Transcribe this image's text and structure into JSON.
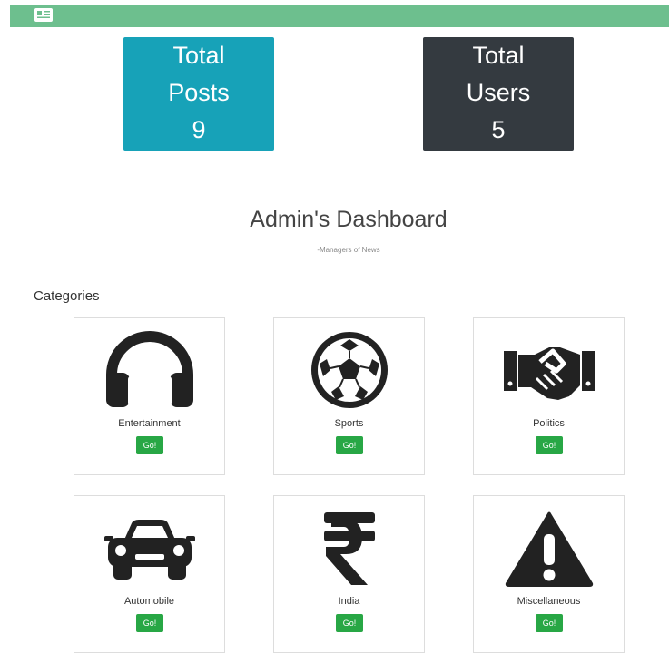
{
  "topbar": {
    "icon": "newspaper-icon",
    "color": "#6dbf8e"
  },
  "stats": {
    "posts": {
      "line1": "Total",
      "line2": "Posts",
      "value": "9",
      "color": "#17a2b8"
    },
    "users": {
      "line1": "Total",
      "line2": "Users",
      "value": "5",
      "color": "#343a40"
    }
  },
  "dashboard": {
    "title": "Admin's Dashboard",
    "subtitle": "-Managers of News"
  },
  "categories": {
    "heading": "Categories",
    "items": [
      {
        "label": "Entertainment",
        "icon": "headphones-icon",
        "button": "Go!"
      },
      {
        "label": "Sports",
        "icon": "soccer-ball-icon",
        "button": "Go!"
      },
      {
        "label": "Politics",
        "icon": "handshake-icon",
        "button": "Go!"
      },
      {
        "label": "Automobile",
        "icon": "car-icon",
        "button": "Go!"
      },
      {
        "label": "India",
        "icon": "rupee-icon",
        "button": "Go!"
      },
      {
        "label": "Miscellaneous",
        "icon": "warning-icon",
        "button": "Go!"
      }
    ]
  }
}
